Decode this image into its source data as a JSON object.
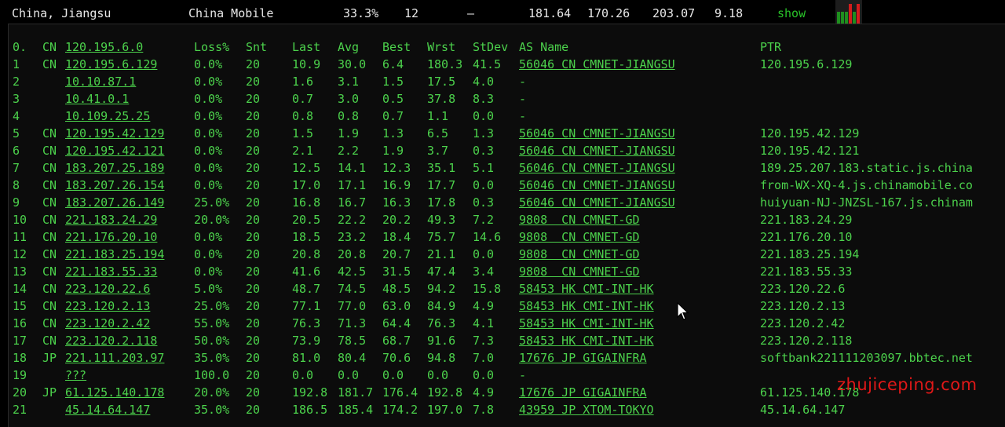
{
  "summary": {
    "location": "China, Jiangsu",
    "isp": "China Mobile",
    "loss": "33.3%",
    "sent": "12",
    "dash": "–",
    "last": "181.64",
    "best": "170.26",
    "worst": "203.07",
    "stdev": "9.18",
    "show_label": "show",
    "mini_chart_bars": [
      {
        "color": "#1e8f1e",
        "level": 0.55
      },
      {
        "color": "#1e8f1e",
        "level": 0.55
      },
      {
        "color": "#1e8f1e",
        "level": 0.55
      },
      {
        "color": "#d41c1c",
        "level": 0.9
      },
      {
        "color": "#1e8f1e",
        "level": 0.55
      },
      {
        "color": "#d41c1c",
        "level": 0.9
      }
    ]
  },
  "mtr": {
    "header": {
      "idx": "0.",
      "cc": "CN",
      "ip": "120.195.6.0",
      "loss": "Loss%",
      "snt": "Snt",
      "last": "Last",
      "avg": "Avg",
      "best": "Best",
      "wrst": "Wrst",
      "stdev": "StDev",
      "asname": "AS Name",
      "ptr": "PTR"
    },
    "rows": [
      {
        "idx": "1",
        "cc": "CN",
        "ip": "120.195.6.129",
        "loss": "0.0%",
        "snt": "20",
        "last": "10.9",
        "avg": "30.0",
        "best": "6.4",
        "wrst": "180.3",
        "stdev": "41.5",
        "asname": "56046 CN CMNET-JIANGSU",
        "ptr": "120.195.6.129"
      },
      {
        "idx": "2",
        "cc": "",
        "ip": "10.10.87.1",
        "loss": "0.0%",
        "snt": "20",
        "last": "1.6",
        "avg": "3.1",
        "best": "1.5",
        "wrst": "17.5",
        "stdev": "4.0",
        "asname": "-",
        "ptr": ""
      },
      {
        "idx": "3",
        "cc": "",
        "ip": "10.41.0.1",
        "loss": "0.0%",
        "snt": "20",
        "last": "0.7",
        "avg": "3.0",
        "best": "0.5",
        "wrst": "37.8",
        "stdev": "8.3",
        "asname": "-",
        "ptr": ""
      },
      {
        "idx": "4",
        "cc": "",
        "ip": "10.109.25.25",
        "loss": "0.0%",
        "snt": "20",
        "last": "0.8",
        "avg": "0.8",
        "best": "0.7",
        "wrst": "1.1",
        "stdev": "0.0",
        "asname": "-",
        "ptr": ""
      },
      {
        "idx": "5",
        "cc": "CN",
        "ip": "120.195.42.129",
        "loss": "0.0%",
        "snt": "20",
        "last": "1.5",
        "avg": "1.9",
        "best": "1.3",
        "wrst": "6.5",
        "stdev": "1.3",
        "asname": "56046 CN CMNET-JIANGSU",
        "ptr": "120.195.42.129"
      },
      {
        "idx": "6",
        "cc": "CN",
        "ip": "120.195.42.121",
        "loss": "0.0%",
        "snt": "20",
        "last": "2.1",
        "avg": "2.2",
        "best": "1.9",
        "wrst": "3.7",
        "stdev": "0.3",
        "asname": "56046 CN CMNET-JIANGSU",
        "ptr": "120.195.42.121"
      },
      {
        "idx": "7",
        "cc": "CN",
        "ip": "183.207.25.189",
        "loss": "0.0%",
        "snt": "20",
        "last": "12.5",
        "avg": "14.1",
        "best": "12.3",
        "wrst": "35.1",
        "stdev": "5.1",
        "asname": "56046 CN CMNET-JIANGSU",
        "ptr": "189.25.207.183.static.js.china"
      },
      {
        "idx": "8",
        "cc": "CN",
        "ip": "183.207.26.154",
        "loss": "0.0%",
        "snt": "20",
        "last": "17.0",
        "avg": "17.1",
        "best": "16.9",
        "wrst": "17.7",
        "stdev": "0.0",
        "asname": "56046 CN CMNET-JIANGSU",
        "ptr": "from-WX-XQ-4.js.chinamobile.co"
      },
      {
        "idx": "9",
        "cc": "CN",
        "ip": "183.207.26.149",
        "loss": "25.0%",
        "snt": "20",
        "last": "16.8",
        "avg": "16.7",
        "best": "16.3",
        "wrst": "17.8",
        "stdev": "0.3",
        "asname": "56046 CN CMNET-JIANGSU",
        "ptr": "huiyuan-NJ-JNZSL-167.js.chinam"
      },
      {
        "idx": "10",
        "cc": "CN",
        "ip": "221.183.24.29",
        "loss": "20.0%",
        "snt": "20",
        "last": "20.5",
        "avg": "22.2",
        "best": "20.2",
        "wrst": "49.3",
        "stdev": "7.2",
        "asname": "9808  CN CMNET-GD",
        "ptr": "221.183.24.29"
      },
      {
        "idx": "11",
        "cc": "CN",
        "ip": "221.176.20.10",
        "loss": "0.0%",
        "snt": "20",
        "last": "18.5",
        "avg": "23.2",
        "best": "18.4",
        "wrst": "75.7",
        "stdev": "14.6",
        "asname": "9808  CN CMNET-GD",
        "ptr": "221.176.20.10"
      },
      {
        "idx": "12",
        "cc": "CN",
        "ip": "221.183.25.194",
        "loss": "0.0%",
        "snt": "20",
        "last": "20.8",
        "avg": "20.8",
        "best": "20.7",
        "wrst": "21.1",
        "stdev": "0.0",
        "asname": "9808  CN CMNET-GD",
        "ptr": "221.183.25.194"
      },
      {
        "idx": "13",
        "cc": "CN",
        "ip": "221.183.55.33",
        "loss": "0.0%",
        "snt": "20",
        "last": "41.6",
        "avg": "42.5",
        "best": "31.5",
        "wrst": "47.4",
        "stdev": "3.4",
        "asname": "9808  CN CMNET-GD",
        "ptr": "221.183.55.33"
      },
      {
        "idx": "14",
        "cc": "CN",
        "ip": "223.120.22.6",
        "loss": "5.0%",
        "snt": "20",
        "last": "48.7",
        "avg": "74.5",
        "best": "48.5",
        "wrst": "94.2",
        "stdev": "15.8",
        "asname": "58453 HK CMI-INT-HK",
        "ptr": "223.120.22.6"
      },
      {
        "idx": "15",
        "cc": "CN",
        "ip": "223.120.2.13",
        "loss": "25.0%",
        "snt": "20",
        "last": "77.1",
        "avg": "77.0",
        "best": "63.0",
        "wrst": "84.9",
        "stdev": "4.9",
        "asname": "58453 HK CMI-INT-HK",
        "ptr": "223.120.2.13"
      },
      {
        "idx": "16",
        "cc": "CN",
        "ip": "223.120.2.42",
        "loss": "55.0%",
        "snt": "20",
        "last": "76.3",
        "avg": "71.3",
        "best": "64.4",
        "wrst": "76.3",
        "stdev": "4.1",
        "asname": "58453 HK CMI-INT-HK",
        "ptr": "223.120.2.42"
      },
      {
        "idx": "17",
        "cc": "CN",
        "ip": "223.120.2.118",
        "loss": "50.0%",
        "snt": "20",
        "last": "73.9",
        "avg": "78.5",
        "best": "68.7",
        "wrst": "91.6",
        "stdev": "7.3",
        "asname": "58453 HK CMI-INT-HK",
        "ptr": "223.120.2.118"
      },
      {
        "idx": "18",
        "cc": "JP",
        "ip": "221.111.203.97",
        "loss": "35.0%",
        "snt": "20",
        "last": "81.0",
        "avg": "80.4",
        "best": "70.6",
        "wrst": "94.8",
        "stdev": "7.0",
        "asname": "17676 JP GIGAINFRA",
        "ptr": "softbank221111203097.bbtec.net"
      },
      {
        "idx": "19",
        "cc": "",
        "ip": "???",
        "loss": "100.0",
        "snt": "20",
        "last": "0.0",
        "avg": "0.0",
        "best": "0.0",
        "wrst": "0.0",
        "stdev": "0.0",
        "asname": "-",
        "ptr": ""
      },
      {
        "idx": "20",
        "cc": "JP",
        "ip": "61.125.140.178",
        "loss": "20.0%",
        "snt": "20",
        "last": "192.8",
        "avg": "181.7",
        "best": "176.4",
        "wrst": "192.8",
        "stdev": "4.9",
        "asname": "17676 JP GIGAINFRA",
        "ptr": "61.125.140.178"
      },
      {
        "idx": "21",
        "cc": "",
        "ip": "45.14.64.147",
        "loss": "35.0%",
        "snt": "20",
        "last": "186.5",
        "avg": "185.4",
        "best": "174.2",
        "wrst": "197.0",
        "stdev": "7.8",
        "asname": "43959 JP XTOM-TOKYO",
        "ptr": "45.14.64.147"
      }
    ]
  },
  "watermark": "zhujiceping.com",
  "colors": {
    "terminal_green": "#4cd24c",
    "summary_text": "#e8e8e8",
    "watermark_red": "#e01818"
  }
}
